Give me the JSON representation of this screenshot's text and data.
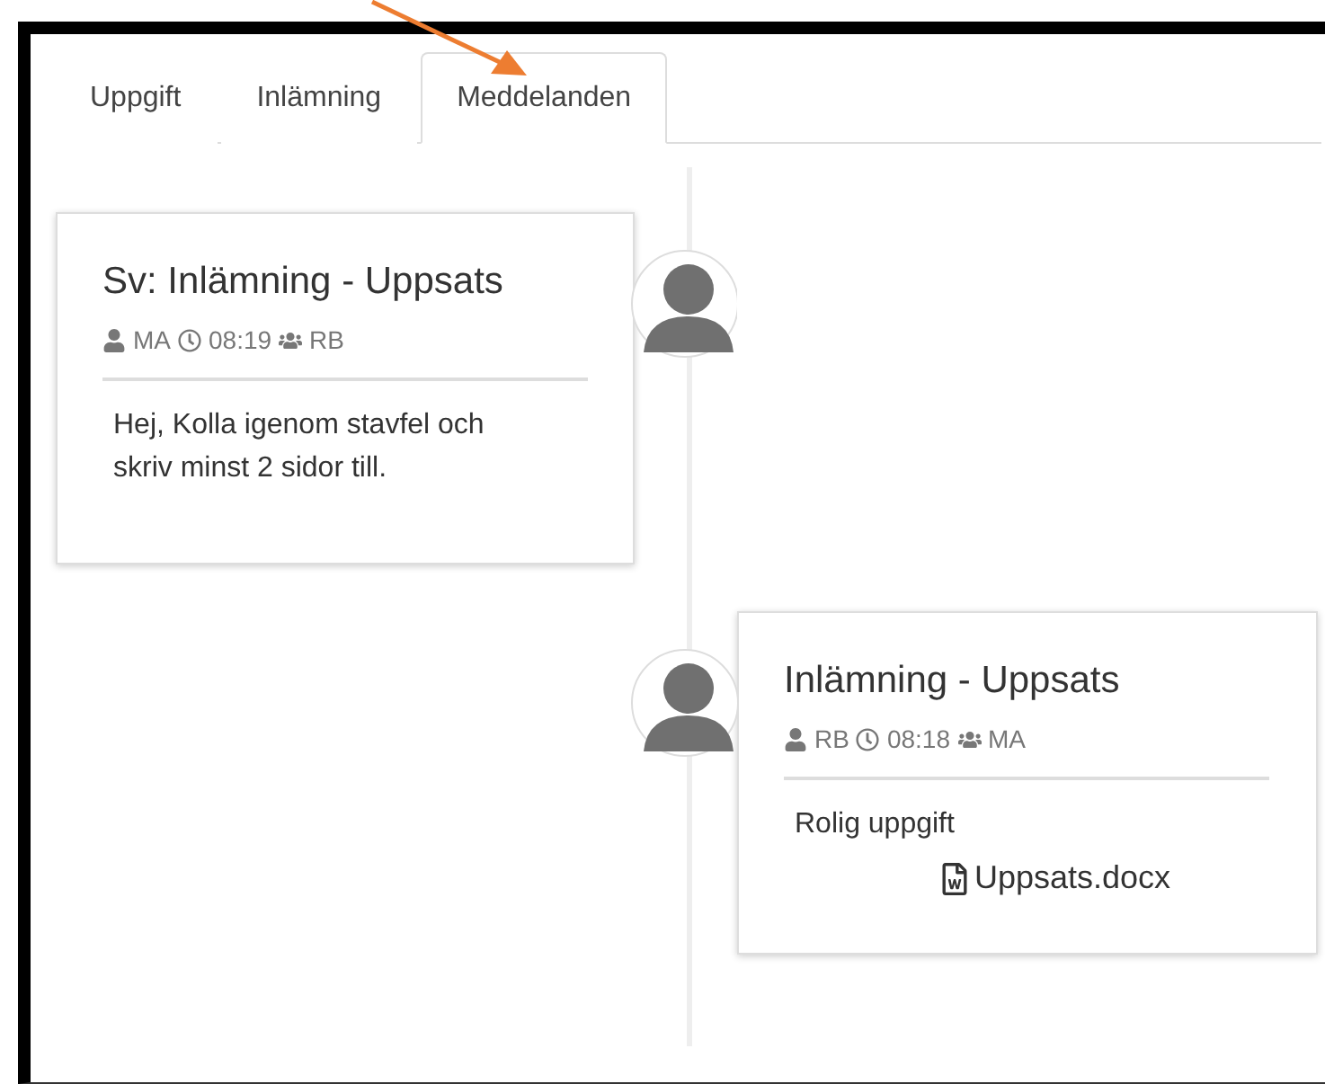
{
  "tabs": [
    {
      "label": "Uppgift",
      "selected": false
    },
    {
      "label": "Inlämning",
      "selected": false
    },
    {
      "label": "Meddelanden",
      "selected": true
    }
  ],
  "messages": [
    {
      "kind": "left",
      "title": "Sv: Inlämning - Uppsats",
      "author": "MA",
      "time": "08:19",
      "recipient": "RB",
      "body": "Hej, Kolla igenom stavfel och skriv minst 2 sidor till."
    },
    {
      "kind": "right",
      "title": "Inlämning - Uppsats",
      "author": "RB",
      "time": "08:18",
      "recipient": "MA",
      "body": "Rolig uppgift",
      "attachments": [
        "Uppsats.docx"
      ]
    }
  ]
}
